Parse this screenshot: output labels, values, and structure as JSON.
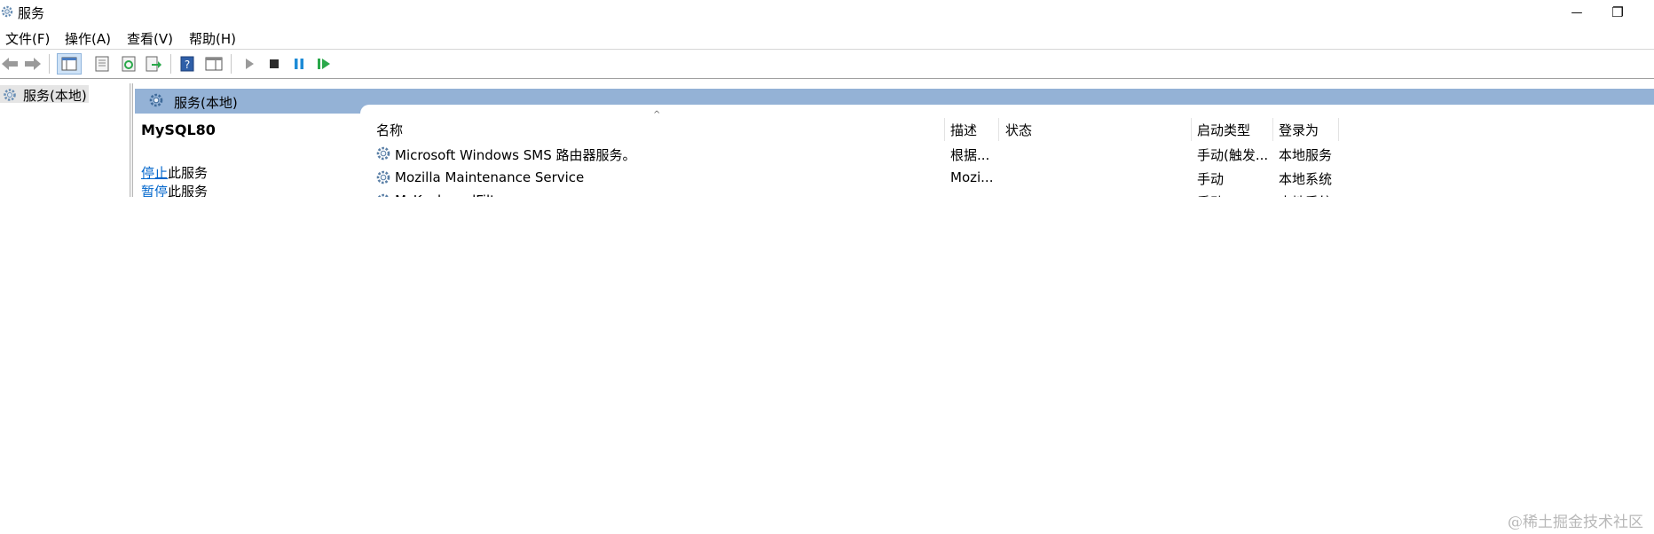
{
  "window": {
    "title": "服务",
    "minimize_glyph": "—",
    "restore_glyph": "❐"
  },
  "menu": [
    "文件(F)",
    "操作(A)",
    "查看(V)",
    "帮助(H)"
  ],
  "toolbar": {
    "icons": [
      "back-arrow-icon",
      "forward-arrow-icon",
      "console-tree-icon",
      "properties-icon",
      "refresh-icon",
      "export-list-icon",
      "help-icon",
      "show-action-pane-icon",
      "start-service-icon",
      "stop-service-icon",
      "pause-service-icon",
      "restart-service-icon"
    ],
    "colors": {
      "start": "#9a9a9a",
      "stop": "#2b2b2b",
      "pause": "#1e8bd6",
      "restart": "#2aa84a"
    }
  },
  "tree": {
    "item_label": "服务(本地)"
  },
  "header": {
    "title": "服务(本地)",
    "color": "#94b2d6"
  },
  "detail": {
    "service_name": "MySQL80",
    "stop_link": "停止",
    "stop_suffix": "此服务",
    "pause_link": "暂停",
    "pause_suffix": "此服务"
  },
  "list": {
    "columns": [
      "名称",
      "描述",
      "状态",
      "启动类型",
      "登录为"
    ],
    "sort_indicator": "^",
    "rows": [
      {
        "name": "Microsoft Windows SMS 路由器服务。",
        "description": "根据...",
        "status": "",
        "startup": "手动(触发...",
        "logon": "本地服务"
      },
      {
        "name": "Mozilla Maintenance Service",
        "description": "Mozi...",
        "status": "",
        "startup": "手动",
        "logon": "本地系统"
      },
      {
        "name": "MsKeyboardFilter",
        "description": "",
        "status": "",
        "startup": "手动",
        "logon": "本地系统"
      }
    ]
  },
  "watermark": "@稀土掘金技术社区"
}
